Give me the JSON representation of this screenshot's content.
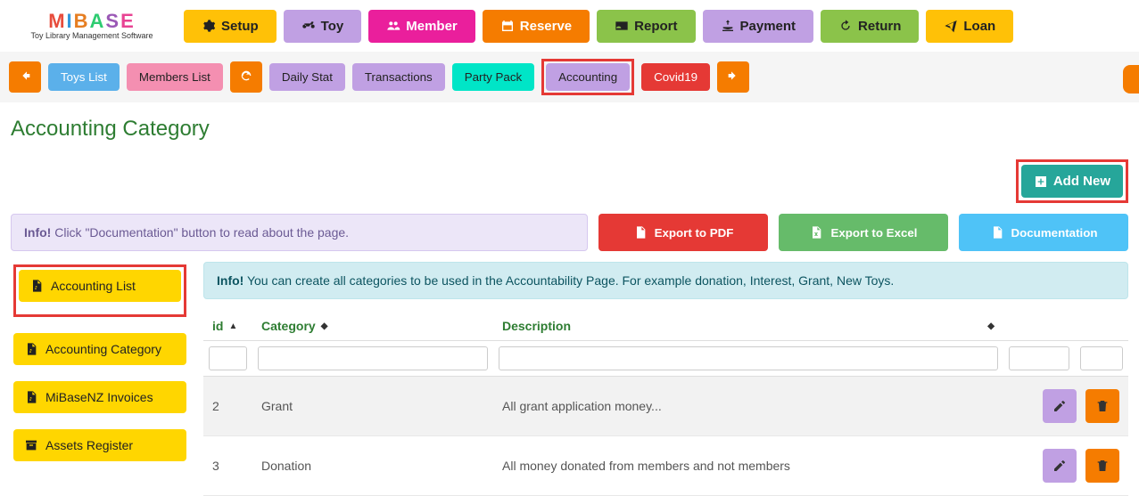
{
  "logo": {
    "sub": "Toy Library Management Software"
  },
  "nav": {
    "setup": "Setup",
    "toy": "Toy",
    "member": "Member",
    "reserve": "Reserve",
    "report": "Report",
    "payment": "Payment",
    "return": "Return",
    "loan": "Loan"
  },
  "subnav": {
    "toys": "Toys List",
    "members": "Members List",
    "daily": "Daily Stat",
    "trans": "Transactions",
    "party": "Party Pack",
    "acct": "Accounting",
    "covid": "Covid19"
  },
  "page_title": "Accounting Category",
  "add_new": "Add New",
  "info1_label": "Info!",
  "info1_text": " Click \"Documentation\" button to read about the page.",
  "export_pdf": "Export to PDF",
  "export_excel": "Export to Excel",
  "documentation": "Documentation",
  "sidebar": {
    "acct_list": "Accounting List",
    "acct_cat": "Accounting Category",
    "invoices": "MiBaseNZ Invoices",
    "assets": "Assets Register"
  },
  "info2_label": "Info!",
  "info2_text": " You can create all categories to be used in the Accountability Page. For example donation, Interest, Grant, New Toys.",
  "columns": {
    "id": "id",
    "cat": "Category",
    "desc": "Description"
  },
  "rows": [
    {
      "id": "2",
      "cat": "Grant",
      "desc": "All grant application money..."
    },
    {
      "id": "3",
      "cat": "Donation",
      "desc": "All money donated from members and not members"
    }
  ]
}
